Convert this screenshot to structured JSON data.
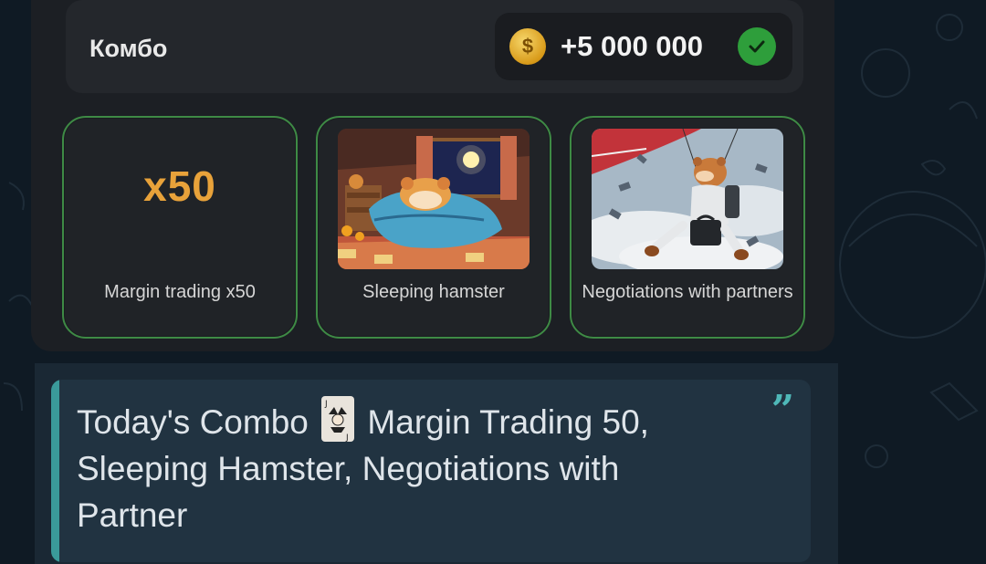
{
  "combo": {
    "title": "Комбо",
    "reward_amount": "+5 000 000",
    "coin_icon": "coin-icon",
    "status_icon": "check-circle-icon",
    "accent_color": "#3e8a45"
  },
  "cards": [
    {
      "label": "Margin trading x50",
      "badge": "x50",
      "image": "x50-text"
    },
    {
      "label": "Sleeping hamster",
      "image": "sleeping-hamster-illustration"
    },
    {
      "label": "Negotiations with partners",
      "image": "skydiving-hamster-illustration"
    }
  ],
  "message": {
    "quote_line1_before": "Today's Combo",
    "quote_line1_after": "Margin Trading 50,",
    "quote_line2": "Sleeping Hamster, Negotiations with",
    "quote_line3": "Partner",
    "emoji_icon": "joker-card-icon",
    "quote_mark": "”",
    "bar_color": "#3a9a9a"
  }
}
